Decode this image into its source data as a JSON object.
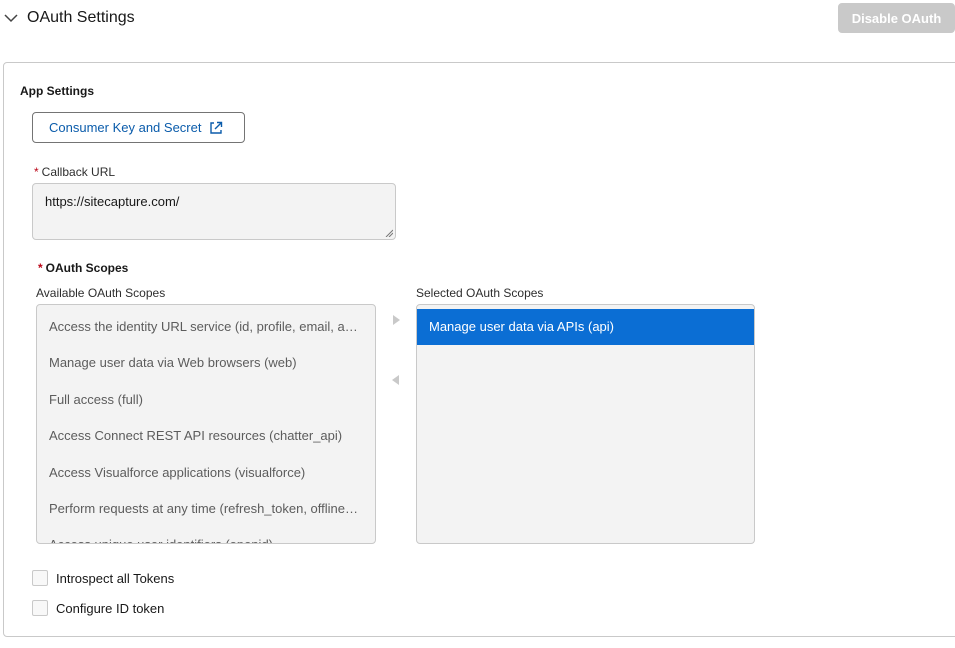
{
  "header": {
    "title": "OAuth Settings",
    "disable_button": "Disable OAuth",
    "expand_icon": "chevron-down-icon"
  },
  "app_settings": {
    "heading": "App Settings",
    "consumer_key_button": "Consumer Key and Secret",
    "consumer_key_icon": "external-link-icon",
    "callback_url": {
      "required_mark": "*",
      "label": "Callback URL",
      "value": "https://sitecapture.com/"
    }
  },
  "oauth_scopes": {
    "required_mark": "*",
    "title": "OAuth Scopes",
    "available_label": "Available OAuth Scopes",
    "selected_label": "Selected OAuth Scopes",
    "available": [
      "Access the identity URL service (id, profile, email, address, phone)",
      "Manage user data via Web browsers (web)",
      "Full access (full)",
      "Access Connect REST API resources (chatter_api)",
      "Access Visualforce applications (visualforce)",
      "Perform requests at any time (refresh_token, offline_access)",
      "Access unique user identifiers (openid)"
    ],
    "selected": [
      "Manage user data via APIs (api)"
    ],
    "move_right_icon": "triangle-right-icon",
    "move_left_icon": "triangle-left-icon"
  },
  "options": {
    "introspect_tokens": {
      "label": "Introspect all Tokens",
      "checked": false
    },
    "configure_id_token": {
      "label": "Configure ID token",
      "checked": false
    }
  },
  "colors": {
    "brand_blue": "#0b5cab",
    "selected_bg": "#0b6ed4",
    "required_red": "#ba0517",
    "disabled_button": "#c9c9c9"
  }
}
